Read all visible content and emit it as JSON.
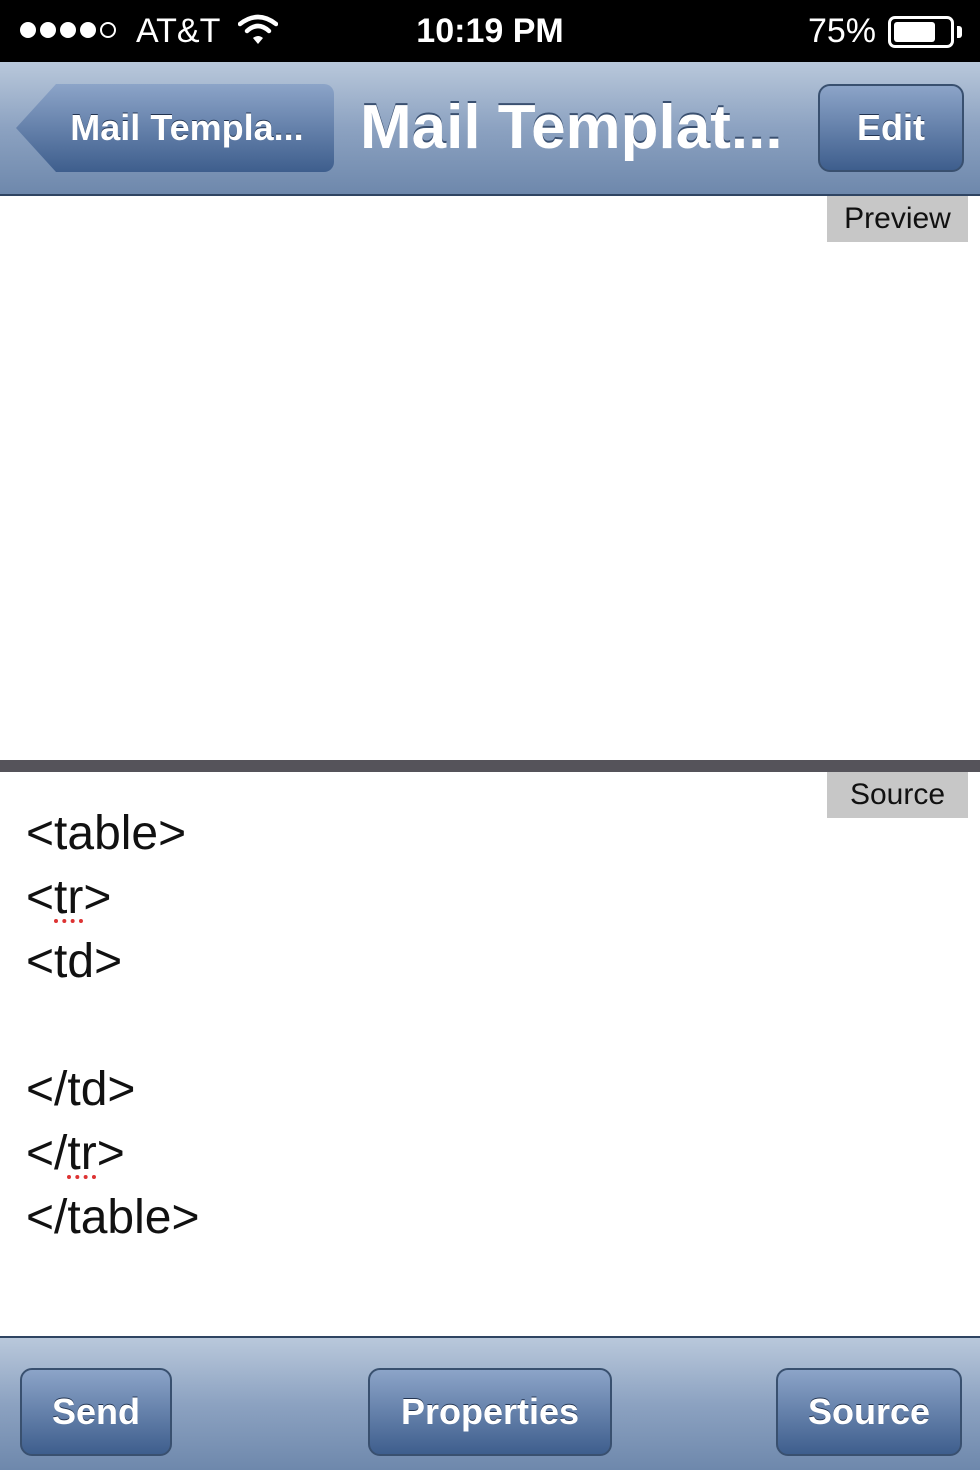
{
  "status_bar": {
    "carrier": "AT&T",
    "time": "10:19 PM",
    "battery": "75%",
    "battery_level": 0.75,
    "signal_bars_filled": 4,
    "signal_bars_total": 5
  },
  "nav": {
    "back_label": "Mail Templa...",
    "title": "Mail Templat...",
    "edit_label": "Edit"
  },
  "preview": {
    "label": "Preview"
  },
  "source": {
    "label": "Source",
    "lines": [
      {
        "pre": "<",
        "mark": "",
        "post": "table>"
      },
      {
        "pre": "<",
        "mark": "tr",
        "post": ">"
      },
      {
        "pre": "<",
        "mark": "",
        "post": "td>"
      },
      {
        "pre": "",
        "mark": "",
        "post": ""
      },
      {
        "pre": "</",
        "mark": "",
        "post": "td>"
      },
      {
        "pre": "</",
        "mark": "tr",
        "post": ">"
      },
      {
        "pre": "</",
        "mark": "",
        "post": "table>"
      }
    ]
  },
  "toolbar": {
    "send_label": "Send",
    "properties_label": "Properties",
    "source_label": "Source"
  },
  "colors": {
    "bar_top": "#b9c8db",
    "bar_bottom": "#6e88ac",
    "button": "#3e5e8d",
    "divider": "#55535a",
    "pane_label_bg": "#c7c7c7"
  }
}
